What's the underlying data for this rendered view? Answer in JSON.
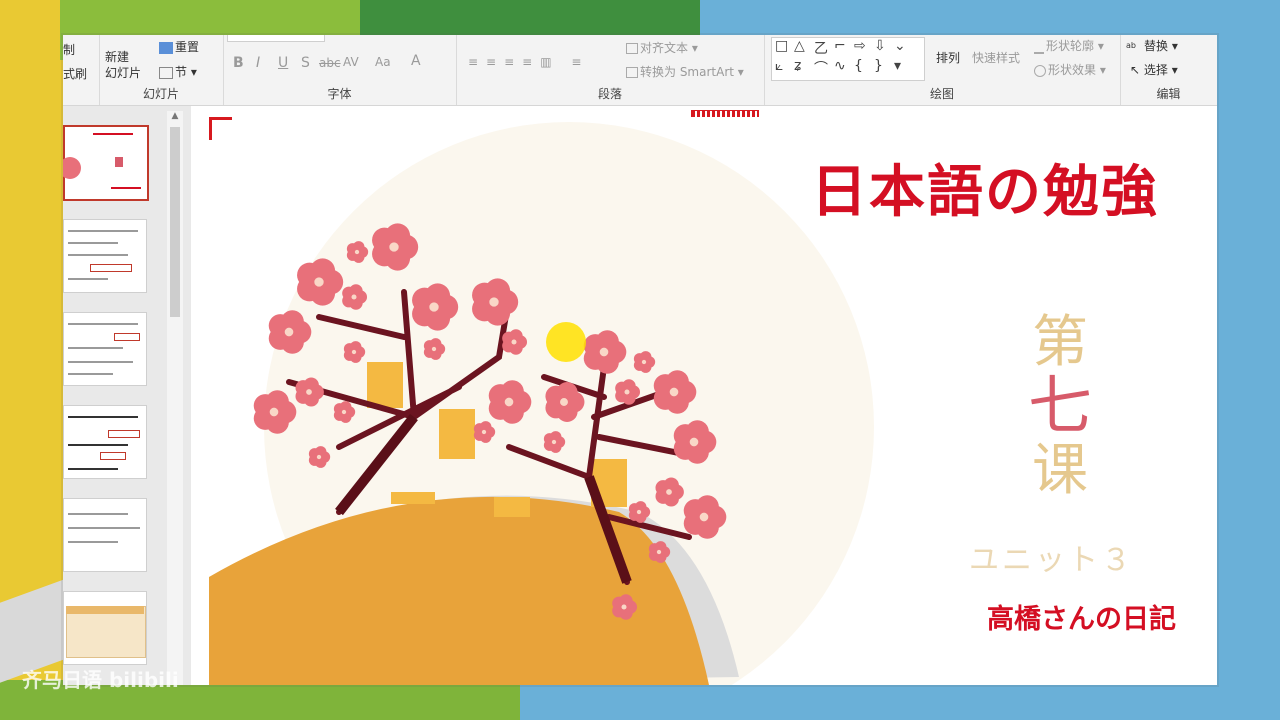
{
  "ribbon": {
    "clipboard": {
      "copy": "制",
      "format_painter": "式刷"
    },
    "slides": {
      "new_slide": "新建\n幻灯片",
      "reset": "重置",
      "section": "节",
      "label": "幻灯片"
    },
    "font": {
      "label": "字体",
      "bold": "B",
      "italic": "I",
      "underline": "U",
      "shadow": "S",
      "strike": "abc",
      "spacing": "AV",
      "case": "Aa",
      "color": "A"
    },
    "paragraph": {
      "label": "段落",
      "align_text": "对齐文本",
      "smartart": "转换为 SmartArt"
    },
    "drawing": {
      "label": "绘图",
      "arrange": "排列",
      "quick_styles": "快速样式",
      "shape_outline": "形状轮廓",
      "shape_effects": "形状效果"
    },
    "editing": {
      "label": "编辑",
      "replace": "替换",
      "select": "选择"
    }
  },
  "slide": {
    "title": "日本語の勉強",
    "lesson_1": "第",
    "lesson_2": "七",
    "lesson_3": "课",
    "unit": "ユニット３",
    "subtitle": "高橋さんの日記"
  },
  "watermark": "齐马日语 bilibili",
  "colors": {
    "accent": "#d40f23",
    "orange": "#e8a33a",
    "petal": "#e8707a"
  }
}
